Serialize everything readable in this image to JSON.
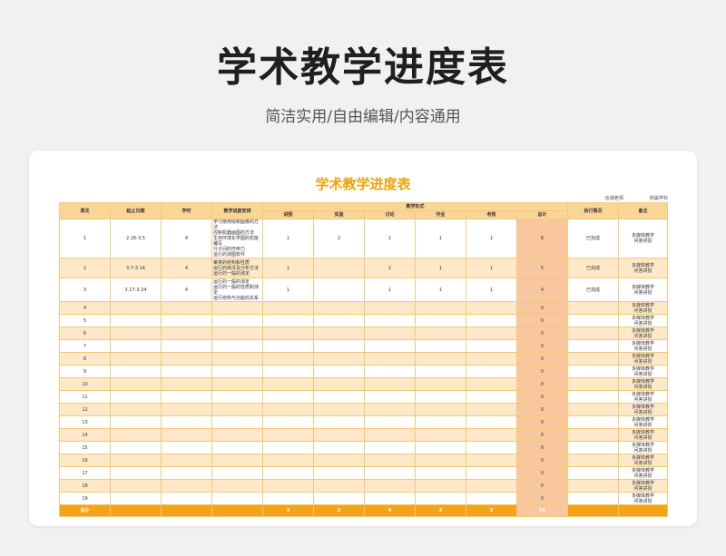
{
  "hero": {
    "title": "学术教学进度表",
    "subtitle": "简洁实用/自由编辑/内容通用"
  },
  "sheet": {
    "title": "学术教学进度表",
    "teacher_label": "任课老师:",
    "subject_label": "所属学科"
  },
  "header": {
    "week": "周次",
    "dates": "起止日期",
    "hours": "学时",
    "content": "教学进度安排",
    "form": "教学形式",
    "lecture": "讲授",
    "experiment": "实验",
    "discussion": "讨论",
    "homework": "作业",
    "exam": "考核",
    "total": "总计",
    "status": "执行情况",
    "note": "备注"
  },
  "rows": [
    {
      "week": "1",
      "dates": "2.26-3.5",
      "hours": "4",
      "content": [
        "学习使用绘制图像的方法",
        "控制机器画图的方法",
        "生存环境化学图的机能编写",
        "分子间的作用力",
        "运行的测图软件"
      ],
      "lecture": "1",
      "experiment": "2",
      "discussion": "1",
      "homework": "1",
      "exam": "1",
      "total": "6",
      "status": "已完成",
      "note": [
        "多媒体教学",
        "问答讲授"
      ]
    },
    {
      "week": "2",
      "dates": "3.7-3.14",
      "hours": "4",
      "content": [
        "某类的结构和性质",
        "运行的用法及分析方法",
        "运行的一般的测定"
      ],
      "lecture": "1",
      "experiment": "",
      "discussion": "2",
      "homework": "1",
      "exam": "1",
      "total": "5",
      "status": "已完成",
      "note": [
        "多媒体教学",
        "问答讲授"
      ]
    },
    {
      "week": "3",
      "dates": "3.17-3.24",
      "hours": "4",
      "content": [
        "运行的一般的测定",
        "运行的一般的性质和测定",
        "运行结构与功能的关系"
      ],
      "lecture": "1",
      "experiment": "",
      "discussion": "1",
      "homework": "1",
      "exam": "1",
      "total": "4",
      "status": "已完成",
      "note": [
        "多媒体教学",
        "问答讲授"
      ]
    },
    {
      "week": "4",
      "dates": "",
      "hours": "",
      "content": [],
      "lecture": "",
      "experiment": "",
      "discussion": "",
      "homework": "",
      "exam": "",
      "total": "0",
      "status": "",
      "note": [
        "多媒体教学",
        "问答讲授"
      ]
    },
    {
      "week": "5",
      "dates": "",
      "hours": "",
      "content": [],
      "lecture": "",
      "experiment": "",
      "discussion": "",
      "homework": "",
      "exam": "",
      "total": "0",
      "status": "",
      "note": [
        "多媒体教学",
        "问答讲授"
      ]
    },
    {
      "week": "6",
      "dates": "",
      "hours": "",
      "content": [],
      "lecture": "",
      "experiment": "",
      "discussion": "",
      "homework": "",
      "exam": "",
      "total": "0",
      "status": "",
      "note": [
        "多媒体教学",
        "问答讲授"
      ]
    },
    {
      "week": "7",
      "dates": "",
      "hours": "",
      "content": [],
      "lecture": "",
      "experiment": "",
      "discussion": "",
      "homework": "",
      "exam": "",
      "total": "0",
      "status": "",
      "note": [
        "多媒体教学",
        "问答讲授"
      ]
    },
    {
      "week": "8",
      "dates": "",
      "hours": "",
      "content": [],
      "lecture": "",
      "experiment": "",
      "discussion": "",
      "homework": "",
      "exam": "",
      "total": "0",
      "status": "",
      "note": [
        "多媒体教学",
        "问答讲授"
      ]
    },
    {
      "week": "9",
      "dates": "",
      "hours": "",
      "content": [],
      "lecture": "",
      "experiment": "",
      "discussion": "",
      "homework": "",
      "exam": "",
      "total": "0",
      "status": "",
      "note": [
        "多媒体教学",
        "问答讲授"
      ]
    },
    {
      "week": "10",
      "dates": "",
      "hours": "",
      "content": [],
      "lecture": "",
      "experiment": "",
      "discussion": "",
      "homework": "",
      "exam": "",
      "total": "0",
      "status": "",
      "note": [
        "多媒体教学",
        "问答讲授"
      ]
    },
    {
      "week": "11",
      "dates": "",
      "hours": "",
      "content": [],
      "lecture": "",
      "experiment": "",
      "discussion": "",
      "homework": "",
      "exam": "",
      "total": "0",
      "status": "",
      "note": [
        "多媒体教学",
        "问答讲授"
      ]
    },
    {
      "week": "12",
      "dates": "",
      "hours": "",
      "content": [],
      "lecture": "",
      "experiment": "",
      "discussion": "",
      "homework": "",
      "exam": "",
      "total": "0",
      "status": "",
      "note": [
        "多媒体教学",
        "问答讲授"
      ]
    },
    {
      "week": "13",
      "dates": "",
      "hours": "",
      "content": [],
      "lecture": "",
      "experiment": "",
      "discussion": "",
      "homework": "",
      "exam": "",
      "total": "0",
      "status": "",
      "note": [
        "多媒体教学",
        "问答讲授"
      ]
    },
    {
      "week": "14",
      "dates": "",
      "hours": "",
      "content": [],
      "lecture": "",
      "experiment": "",
      "discussion": "",
      "homework": "",
      "exam": "",
      "total": "0",
      "status": "",
      "note": [
        "多媒体教学",
        "问答讲授"
      ]
    },
    {
      "week": "15",
      "dates": "",
      "hours": "",
      "content": [],
      "lecture": "",
      "experiment": "",
      "discussion": "",
      "homework": "",
      "exam": "",
      "total": "0",
      "status": "",
      "note": [
        "多媒体教学",
        "问答讲授"
      ]
    },
    {
      "week": "16",
      "dates": "",
      "hours": "",
      "content": [],
      "lecture": "",
      "experiment": "",
      "discussion": "",
      "homework": "",
      "exam": "",
      "total": "0",
      "status": "",
      "note": [
        "多媒体教学",
        "问答讲授"
      ]
    },
    {
      "week": "17",
      "dates": "",
      "hours": "",
      "content": [],
      "lecture": "",
      "experiment": "",
      "discussion": "",
      "homework": "",
      "exam": "",
      "total": "0",
      "status": "",
      "note": [
        "多媒体教学",
        "问答讲授"
      ]
    },
    {
      "week": "18",
      "dates": "",
      "hours": "",
      "content": [],
      "lecture": "",
      "experiment": "",
      "discussion": "",
      "homework": "",
      "exam": "",
      "total": "0",
      "status": "",
      "note": [
        "多媒体教学",
        "问答讲授"
      ]
    },
    {
      "week": "19",
      "dates": "",
      "hours": "",
      "content": [],
      "lecture": "",
      "experiment": "",
      "discussion": "",
      "homework": "",
      "exam": "",
      "total": "0",
      "status": "",
      "note": [
        "多媒体教学",
        "问答讲授"
      ]
    }
  ],
  "footer": {
    "label": "总计",
    "lecture": "3",
    "experiment": "2",
    "discussion": "4",
    "homework": "3",
    "exam": "3",
    "total": "15"
  }
}
